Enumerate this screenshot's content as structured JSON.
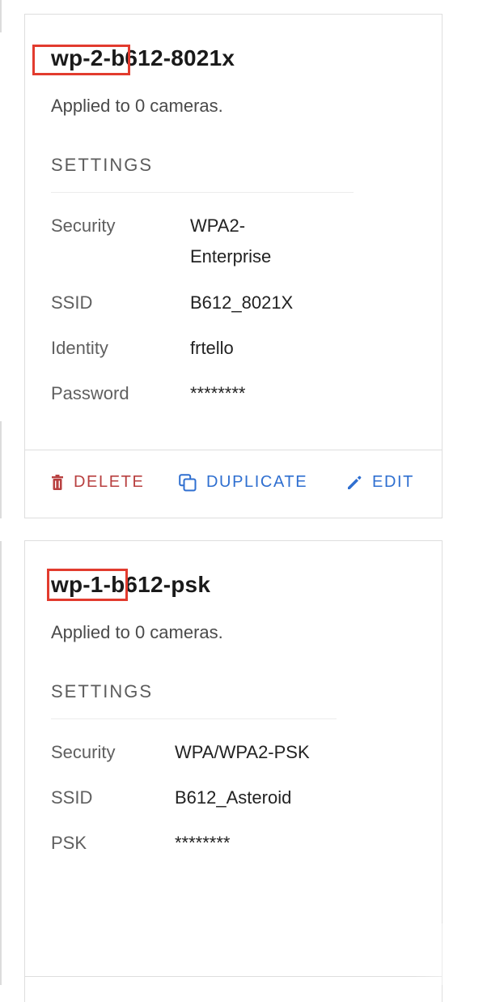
{
  "cards": [
    {
      "title": "wp-2-b612-8021x",
      "applied_text": "Applied to 0 cameras.",
      "settings_heading": "SETTINGS",
      "settings": [
        {
          "label": "Security",
          "value": "WPA2-Enterprise"
        },
        {
          "label": "SSID",
          "value": "B612_8021X"
        },
        {
          "label": "Identity",
          "value": "frtello"
        },
        {
          "label": "Password",
          "value": "********"
        }
      ],
      "actions": {
        "delete": "DELETE",
        "duplicate": "DUPLICATE",
        "edit": "EDIT"
      }
    },
    {
      "title": "wp-1-b612-psk",
      "applied_text": "Applied to 0 cameras.",
      "settings_heading": "SETTINGS",
      "settings": [
        {
          "label": "Security",
          "value": "WPA/WPA2-PSK"
        },
        {
          "label": "SSID",
          "value": "B612_Asteroid"
        },
        {
          "label": "PSK",
          "value": "********"
        }
      ]
    }
  ],
  "colors": {
    "highlight": "#e23b2e",
    "delete": "#b84040",
    "accent": "#2f6fd0"
  },
  "icons": {
    "delete": "trash-icon",
    "duplicate": "duplicate-icon",
    "edit": "pencil-icon"
  }
}
